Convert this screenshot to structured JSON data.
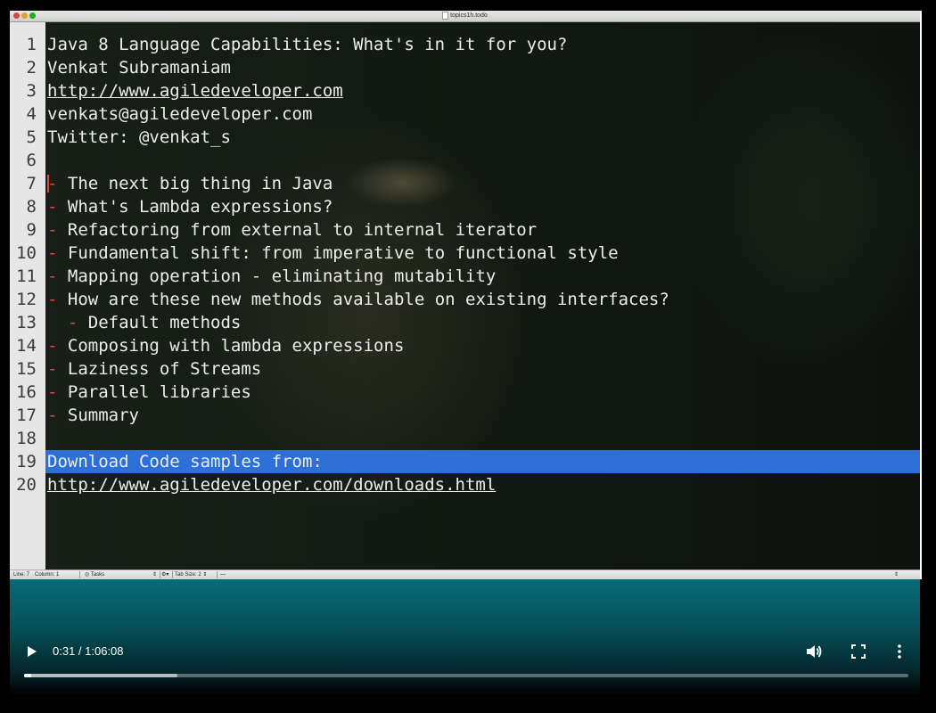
{
  "window": {
    "title": "topics1h.todo"
  },
  "editor": {
    "lines": [
      {
        "num": "1",
        "dash": "",
        "indent": "",
        "text": "Java 8 Language Capabilities: What's in it for you?",
        "link": false
      },
      {
        "num": "2",
        "dash": "",
        "indent": "",
        "text": "Venkat Subramaniam",
        "link": false
      },
      {
        "num": "3",
        "dash": "",
        "indent": "",
        "text": "http://www.agiledeveloper.com",
        "link": true
      },
      {
        "num": "4",
        "dash": "",
        "indent": "",
        "text": "venkats@agiledeveloper.com",
        "link": false
      },
      {
        "num": "5",
        "dash": "",
        "indent": "",
        "text": "Twitter: @venkat_s",
        "link": false
      },
      {
        "num": "6",
        "dash": "",
        "indent": "",
        "text": "",
        "link": false
      },
      {
        "num": "7",
        "dash": "-",
        "indent": "",
        "text": " The next big thing in Java",
        "link": false
      },
      {
        "num": "8",
        "dash": "-",
        "indent": "",
        "text": " What's Lambda expressions?",
        "link": false
      },
      {
        "num": "9",
        "dash": "-",
        "indent": "",
        "text": " Refactoring from external to internal iterator",
        "link": false
      },
      {
        "num": "10",
        "dash": "-",
        "indent": "",
        "text": " Fundamental shift: from imperative to functional style",
        "link": false
      },
      {
        "num": "11",
        "dash": "-",
        "indent": "",
        "text": " Mapping operation - eliminating mutability",
        "link": false
      },
      {
        "num": "12",
        "dash": "-",
        "indent": "",
        "text": " How are these new methods available on existing interfaces?",
        "link": false
      },
      {
        "num": "13",
        "dash": "-",
        "indent": "  ",
        "text": " Default methods",
        "link": false
      },
      {
        "num": "14",
        "dash": "-",
        "indent": "",
        "text": " Composing with lambda expressions",
        "link": false
      },
      {
        "num": "15",
        "dash": "-",
        "indent": "",
        "text": " Laziness of Streams",
        "link": false
      },
      {
        "num": "16",
        "dash": "-",
        "indent": "",
        "text": " Parallel libraries",
        "link": false
      },
      {
        "num": "17",
        "dash": "-",
        "indent": "",
        "text": " Summary",
        "link": false
      },
      {
        "num": "18",
        "dash": "",
        "indent": "",
        "text": "",
        "link": false
      },
      {
        "num": "19",
        "dash": "",
        "indent": "",
        "text": "Download Code samples from:",
        "link": false
      },
      {
        "num": "20",
        "dash": "",
        "indent": "",
        "text": "http://www.agiledeveloper.com/downloads.html",
        "link": true
      }
    ],
    "selected_line": "19",
    "cursor_line": "7"
  },
  "statusbar": {
    "line": "Line: 7",
    "column": "Column: 1",
    "language": "Tasks",
    "tab_size": "Tab Size:",
    "tab_size_value": "2",
    "symbol": "—"
  },
  "player": {
    "current_time": "0:31",
    "duration": "1:06:08",
    "time_display": "0:31 / 1:06:08",
    "progress_fraction": 0.0078,
    "buffered_fraction": 0.173,
    "play_icon": "play-icon",
    "volume_icon": "volume-icon",
    "fullscreen_icon": "fullscreen-icon",
    "more_icon": "more-options-icon"
  }
}
